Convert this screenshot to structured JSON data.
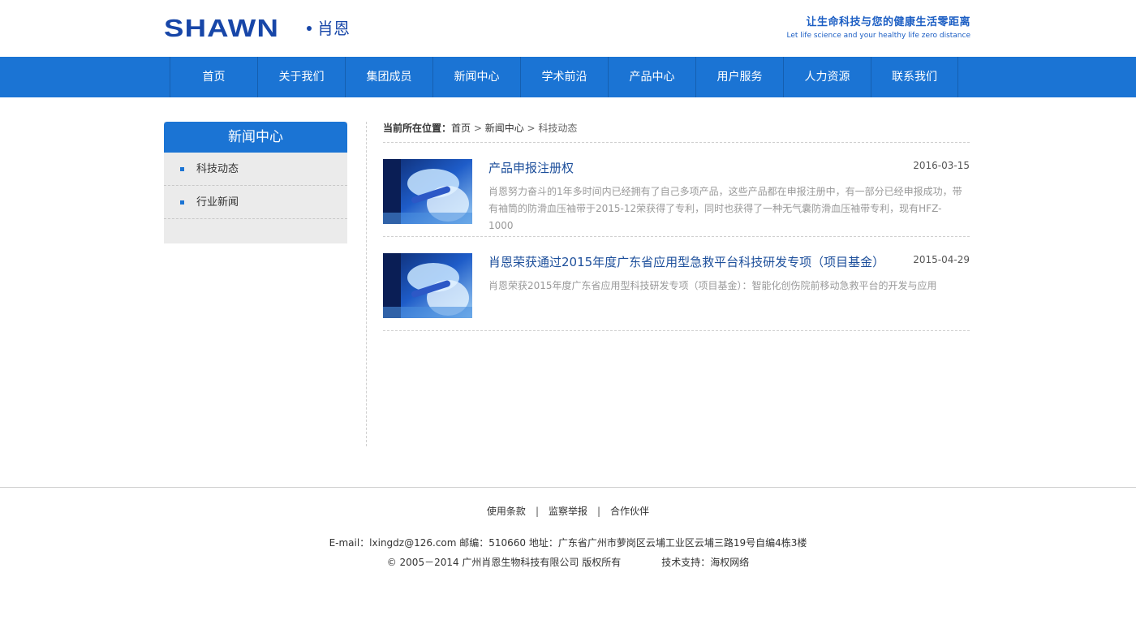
{
  "header": {
    "logo_text": "SHAWN",
    "logo_cn": "肖恩",
    "slogan_cn": "让生命科技与您的健康生活零距离",
    "slogan_en": "Let life science and your healthy life zero distance"
  },
  "nav": {
    "items": [
      "首页",
      "关于我们",
      "集团成员",
      "新闻中心",
      "学术前沿",
      "产品中心",
      "用户服务",
      "人力资源",
      "联系我们"
    ]
  },
  "sidebar": {
    "title": "新闻中心",
    "items": [
      "科技动态",
      "行业新闻"
    ]
  },
  "breadcrumb": {
    "label": "当前所在位置：",
    "home": "首页",
    "section": "新闻中心",
    "current": "科技动态",
    "sep": " > "
  },
  "news": [
    {
      "title": "产品申报注册权",
      "date": "2016-03-15",
      "desc": "肖恩努力奋斗的1年多时间内已经拥有了自己多项产品，这些产品都在申报注册中，有一部分已经申报成功，带有袖筒的防滑血压袖带于2015-12荣获得了专利，同时也获得了一种无气囊防滑血压袖带专利，现有HFZ- 1000"
    },
    {
      "title": "肖恩荣获通过2015年度广东省应用型急救平台科技研发专项（项目基金）",
      "date": "2015-04-29",
      "desc": "肖恩荣获2015年度广东省应用型科技研发专项（项目基金）：智能化创伤院前移动急救平台的开发与应用"
    }
  ],
  "footer": {
    "links": [
      "使用条款",
      "监察举报",
      "合作伙伴"
    ],
    "link_sep": "|",
    "contact": "E-mail：lxingdz@126.com 邮编：510660 地址：广东省广州市萝岗区云埔工业区云埔三路19号自编4栋3楼",
    "copyright": "© 2005－2014 广州肖恩生物科技有限公司 版权所有",
    "support": "技术支持：海权网络"
  },
  "colors": {
    "brand_blue": "#1b74d4",
    "logo_blue": "#1746a8",
    "title_blue": "#1d4f9b"
  }
}
